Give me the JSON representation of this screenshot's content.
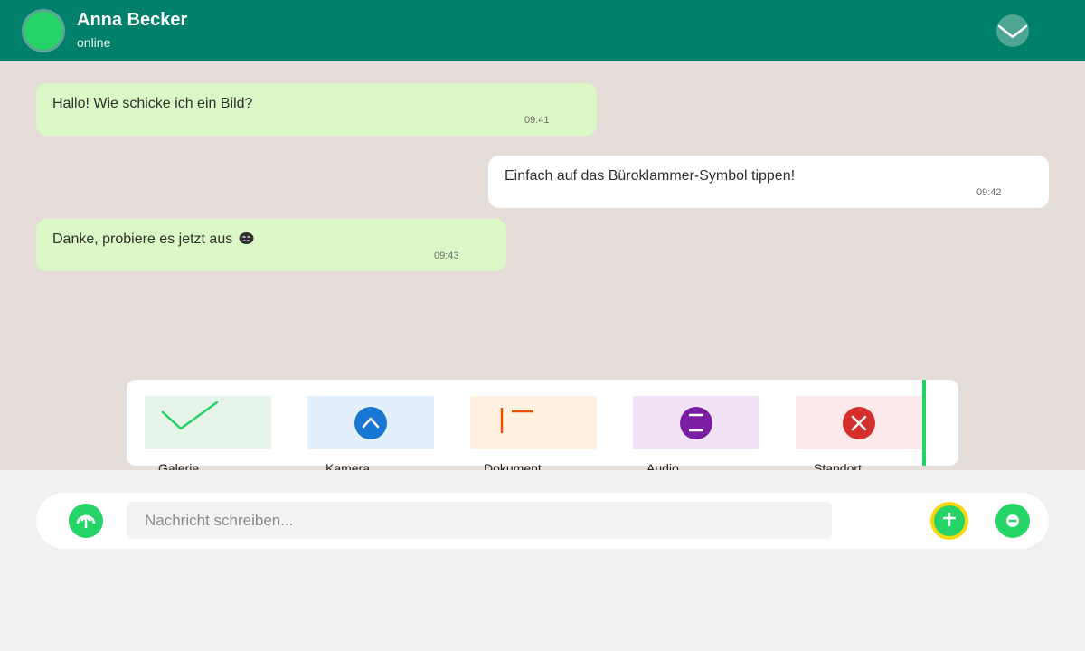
{
  "header": {
    "contact_name": "Anna Becker",
    "status": "online",
    "avatar_color": "#25d366",
    "background": "#00806a",
    "menu_icon": "chevron-down-icon"
  },
  "messages": [
    {
      "direction": "incoming",
      "text": "Hallo! Wie schicke ich ein Bild?",
      "time": "09:41"
    },
    {
      "direction": "outgoing",
      "text": "Einfach auf das Büroklammer-Symbol tippen!",
      "time": "09:42"
    },
    {
      "direction": "incoming",
      "text": "Danke, probiere es jetzt aus",
      "emoji": "smiling-face-icon",
      "time": "09:43"
    }
  ],
  "attachments": {
    "items": [
      {
        "label": "Galerie",
        "icon": "check-icon",
        "tile_color": "#e6f4ea",
        "icon_color": "#25d366"
      },
      {
        "label": "Kamera",
        "icon": "chevron-up-icon",
        "tile_color": "#e3f0fc",
        "icon_color": "#1976d2"
      },
      {
        "label": "Dokument",
        "icon": "document-icon",
        "tile_color": "#fff1e0",
        "icon_color": "#e65100"
      },
      {
        "label": "Audio",
        "icon": "equals-icon",
        "tile_color": "#f1e3f5",
        "icon_color": "#7b1fa2"
      },
      {
        "label": "Standort",
        "icon": "close-icon",
        "tile_color": "#fde8ea",
        "icon_color": "#d32f2f"
      }
    ]
  },
  "composer": {
    "placeholder": "Nachricht schreiben...",
    "value": "",
    "left_button_icon": "upload-icon",
    "attach_button_icon": "add-attachment-icon",
    "attach_button_highlight": "#f5d90a",
    "right_button_icon": "minus-icon",
    "accent": "#25d366"
  }
}
